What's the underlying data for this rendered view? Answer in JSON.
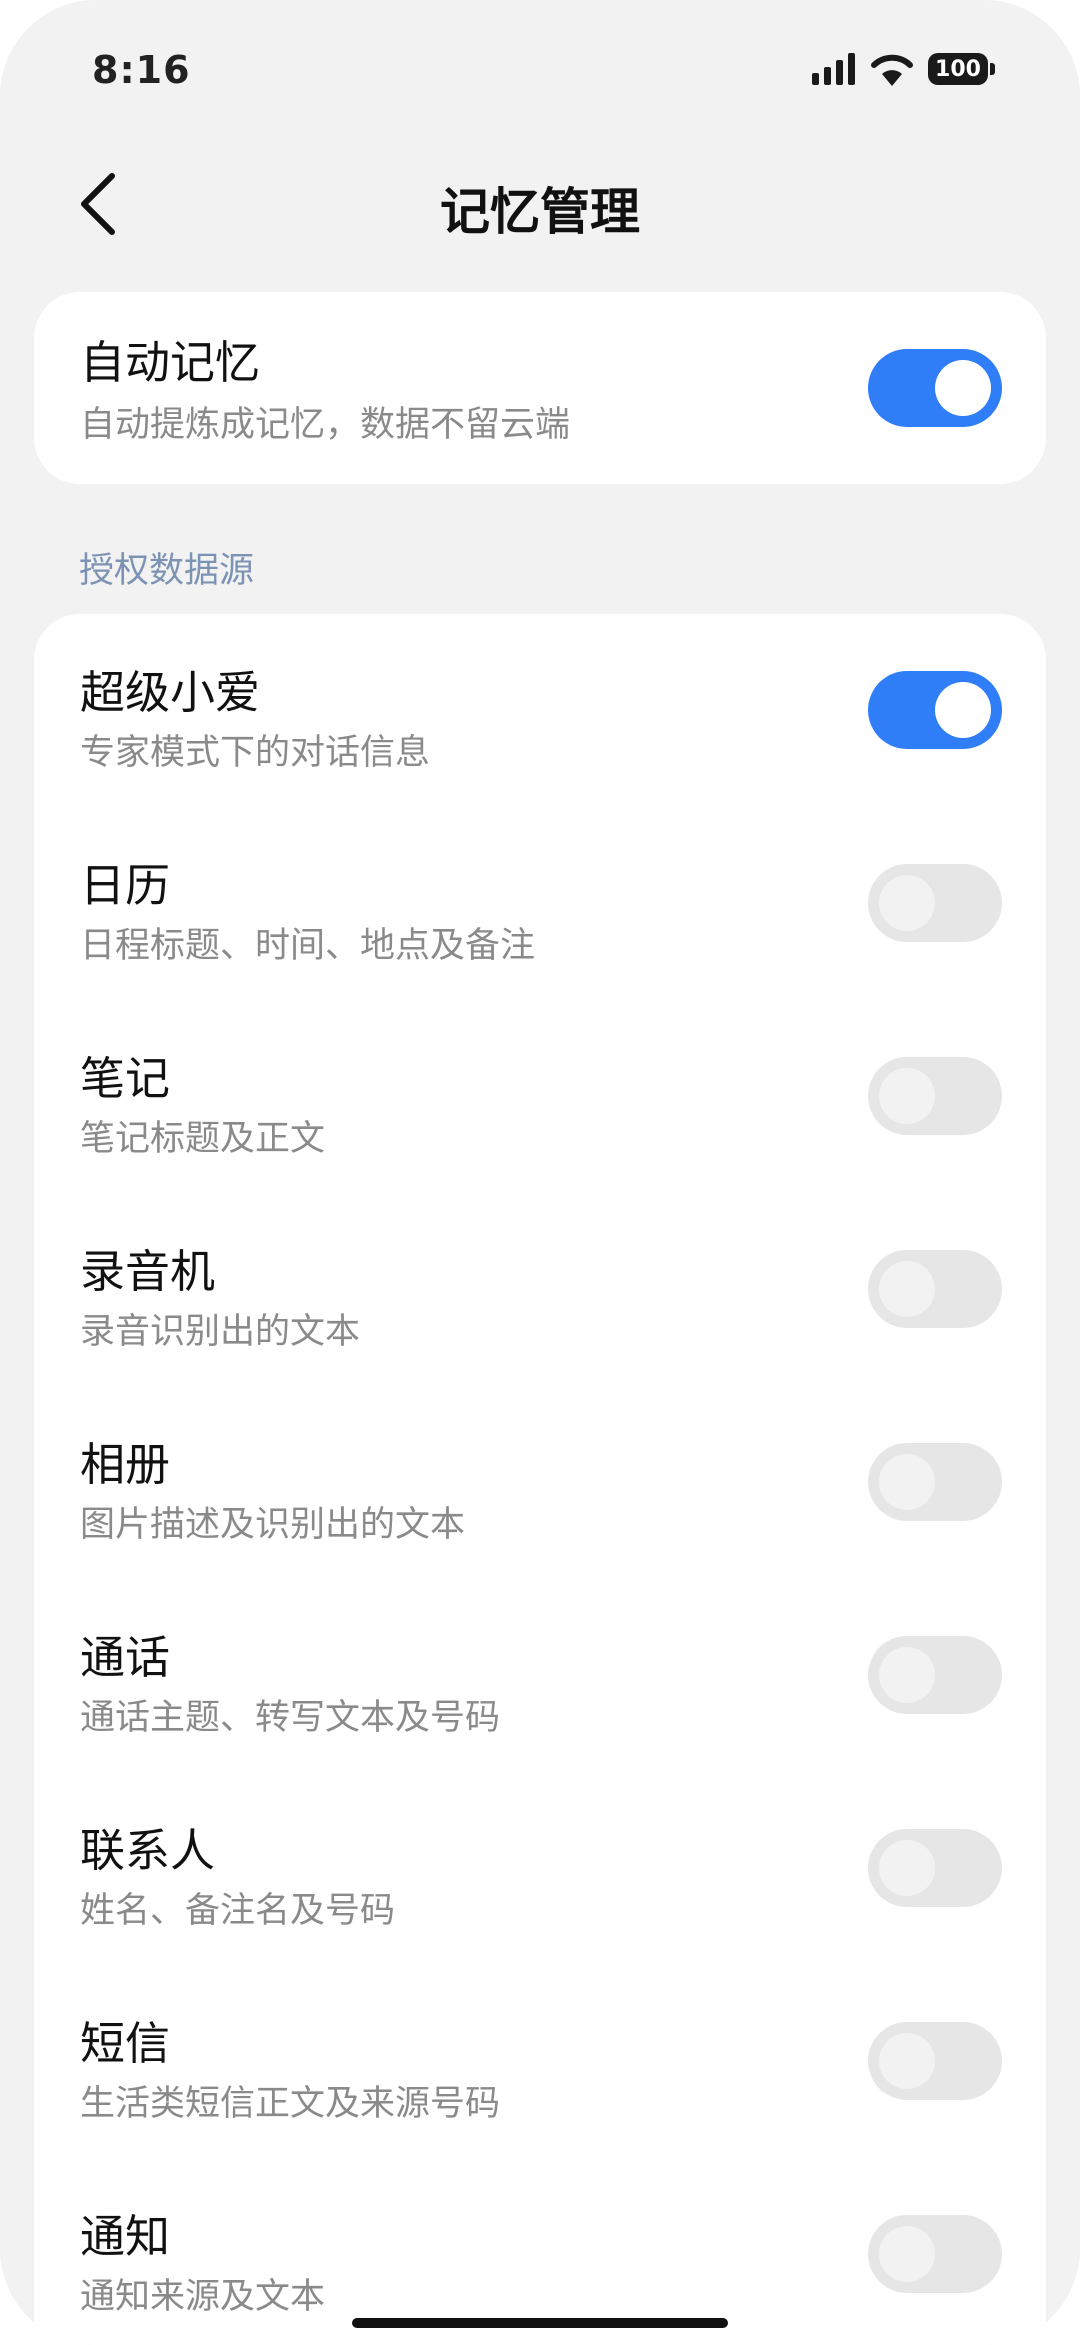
{
  "status_bar": {
    "time": "8:16",
    "battery": "100"
  },
  "header": {
    "title": "记忆管理"
  },
  "auto_memory": {
    "title": "自动记忆",
    "subtitle": "自动提炼成记忆，数据不留云端",
    "enabled": true
  },
  "sources": {
    "section_label": "授权数据源",
    "items": [
      {
        "title": "超级小爱",
        "subtitle": "专家模式下的对话信息",
        "enabled": true
      },
      {
        "title": "日历",
        "subtitle": "日程标题、时间、地点及备注",
        "enabled": false
      },
      {
        "title": "笔记",
        "subtitle": "笔记标题及正文",
        "enabled": false
      },
      {
        "title": "录音机",
        "subtitle": "录音识别出的文本",
        "enabled": false
      },
      {
        "title": "相册",
        "subtitle": "图片描述及识别出的文本",
        "enabled": false
      },
      {
        "title": "通话",
        "subtitle": "通话主题、转写文本及号码",
        "enabled": false
      },
      {
        "title": "联系人",
        "subtitle": "姓名、备注名及号码",
        "enabled": false
      },
      {
        "title": "短信",
        "subtitle": "生活类短信正文及来源号码",
        "enabled": false
      },
      {
        "title": "通知",
        "subtitle": "通知来源及文本",
        "enabled": false
      }
    ]
  },
  "colors": {
    "accent": "#2f7ef7",
    "toggle_off": "#e6e6e6",
    "section_label": "#7d93b4"
  }
}
